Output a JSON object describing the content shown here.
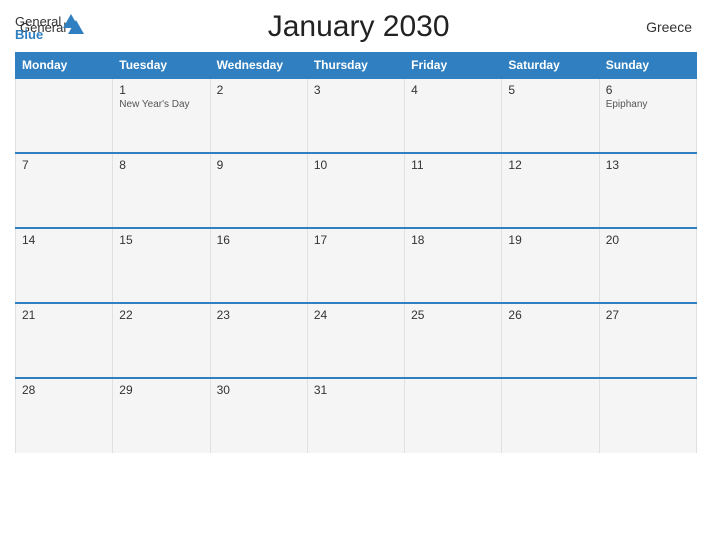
{
  "header": {
    "logo_general": "General",
    "logo_blue": "Blue",
    "title": "January 2030",
    "country": "Greece"
  },
  "days_of_week": [
    "Monday",
    "Tuesday",
    "Wednesday",
    "Thursday",
    "Friday",
    "Saturday",
    "Sunday"
  ],
  "weeks": [
    [
      {
        "day": "",
        "holiday": ""
      },
      {
        "day": "1",
        "holiday": "New Year's Day"
      },
      {
        "day": "2",
        "holiday": ""
      },
      {
        "day": "3",
        "holiday": ""
      },
      {
        "day": "4",
        "holiday": ""
      },
      {
        "day": "5",
        "holiday": ""
      },
      {
        "day": "6",
        "holiday": "Epiphany"
      }
    ],
    [
      {
        "day": "7",
        "holiday": ""
      },
      {
        "day": "8",
        "holiday": ""
      },
      {
        "day": "9",
        "holiday": ""
      },
      {
        "day": "10",
        "holiday": ""
      },
      {
        "day": "11",
        "holiday": ""
      },
      {
        "day": "12",
        "holiday": ""
      },
      {
        "day": "13",
        "holiday": ""
      }
    ],
    [
      {
        "day": "14",
        "holiday": ""
      },
      {
        "day": "15",
        "holiday": ""
      },
      {
        "day": "16",
        "holiday": ""
      },
      {
        "day": "17",
        "holiday": ""
      },
      {
        "day": "18",
        "holiday": ""
      },
      {
        "day": "19",
        "holiday": ""
      },
      {
        "day": "20",
        "holiday": ""
      }
    ],
    [
      {
        "day": "21",
        "holiday": ""
      },
      {
        "day": "22",
        "holiday": ""
      },
      {
        "day": "23",
        "holiday": ""
      },
      {
        "day": "24",
        "holiday": ""
      },
      {
        "day": "25",
        "holiday": ""
      },
      {
        "day": "26",
        "holiday": ""
      },
      {
        "day": "27",
        "holiday": ""
      }
    ],
    [
      {
        "day": "28",
        "holiday": ""
      },
      {
        "day": "29",
        "holiday": ""
      },
      {
        "day": "30",
        "holiday": ""
      },
      {
        "day": "31",
        "holiday": ""
      },
      {
        "day": "",
        "holiday": ""
      },
      {
        "day": "",
        "holiday": ""
      },
      {
        "day": "",
        "holiday": ""
      }
    ]
  ]
}
